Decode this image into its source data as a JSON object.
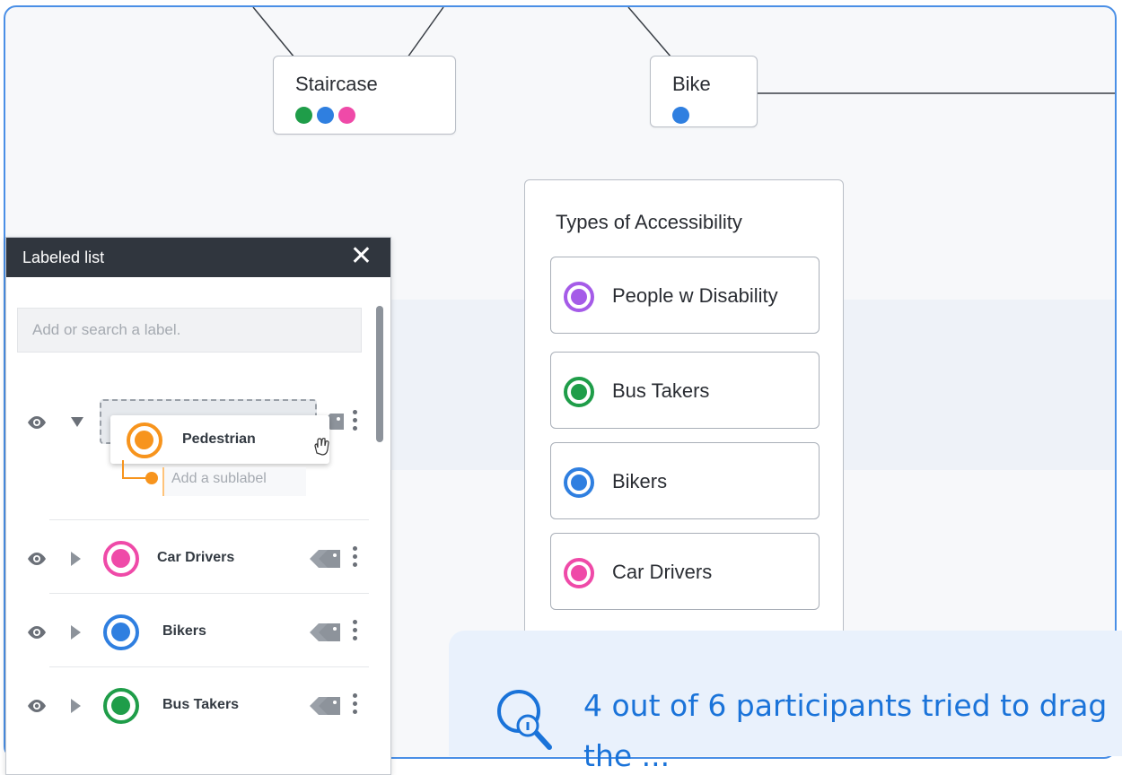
{
  "canvas": {
    "nodes": [
      {
        "title": "Staircase",
        "dot_colors": [
          "#1f9d49",
          "#2f7fe0",
          "#ef4aa8"
        ]
      },
      {
        "title": "Bike",
        "dot_colors": [
          "#2f7fe0"
        ]
      }
    ],
    "accessibility_card": {
      "title": "Types of Accessibility",
      "items": [
        {
          "label": "People w Disability",
          "color": "#a55be8"
        },
        {
          "label": "Bus Takers",
          "color": "#1f9d49"
        },
        {
          "label": "Bikers",
          "color": "#2f7fe0"
        },
        {
          "label": "Car Drivers",
          "color": "#ef4aa8"
        }
      ]
    }
  },
  "labeled_list": {
    "title": "Labeled list",
    "close_icon": "close-icon",
    "search_placeholder": "Add or search a label.",
    "dragging": {
      "label": "Pedestrian",
      "color": "#f7941d",
      "sublabel_placeholder": "Add a sublabel"
    },
    "rows": [
      {
        "label": "Car Drivers",
        "color": "#ef4aa8"
      },
      {
        "label": "Bikers",
        "color": "#2f7fe0"
      },
      {
        "label": "Bus Takers",
        "color": "#1f9d49"
      }
    ]
  },
  "finding": {
    "icon": "search-insight-icon",
    "line1": "4 out of 6 participants tried to drag",
    "line2": "the ..."
  }
}
